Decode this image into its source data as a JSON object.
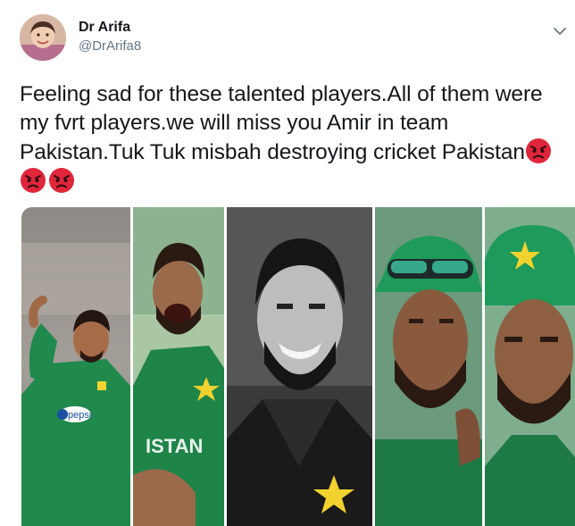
{
  "user": {
    "display_name": "Dr Arifa",
    "handle": "@DrArifa8",
    "avatar_icon": "child-portrait-avatar"
  },
  "tweet": {
    "text": "Feeling sad for these talented players.All of them were my fvrt players.we will miss you Amir in team Pakistan.Tuk Tuk misbah destroying cricket Pakistan",
    "trailing_emojis": [
      "angry-face-emoji",
      "angry-face-emoji",
      "angry-face-emoji"
    ]
  },
  "menu": {
    "icon": "chevron-down-icon"
  },
  "media": {
    "description_icons": [
      "player-1",
      "player-2",
      "player-3-grayscale",
      "player-4",
      "player-5"
    ],
    "jersey_text": "ISTAN",
    "sponsor_text": "pepsi"
  },
  "colors": {
    "jersey_green": "#1f8a4c",
    "cap_green": "#1e9a5a",
    "star_yellow": "#f2d22e",
    "emoji_red": "#e0263a"
  }
}
